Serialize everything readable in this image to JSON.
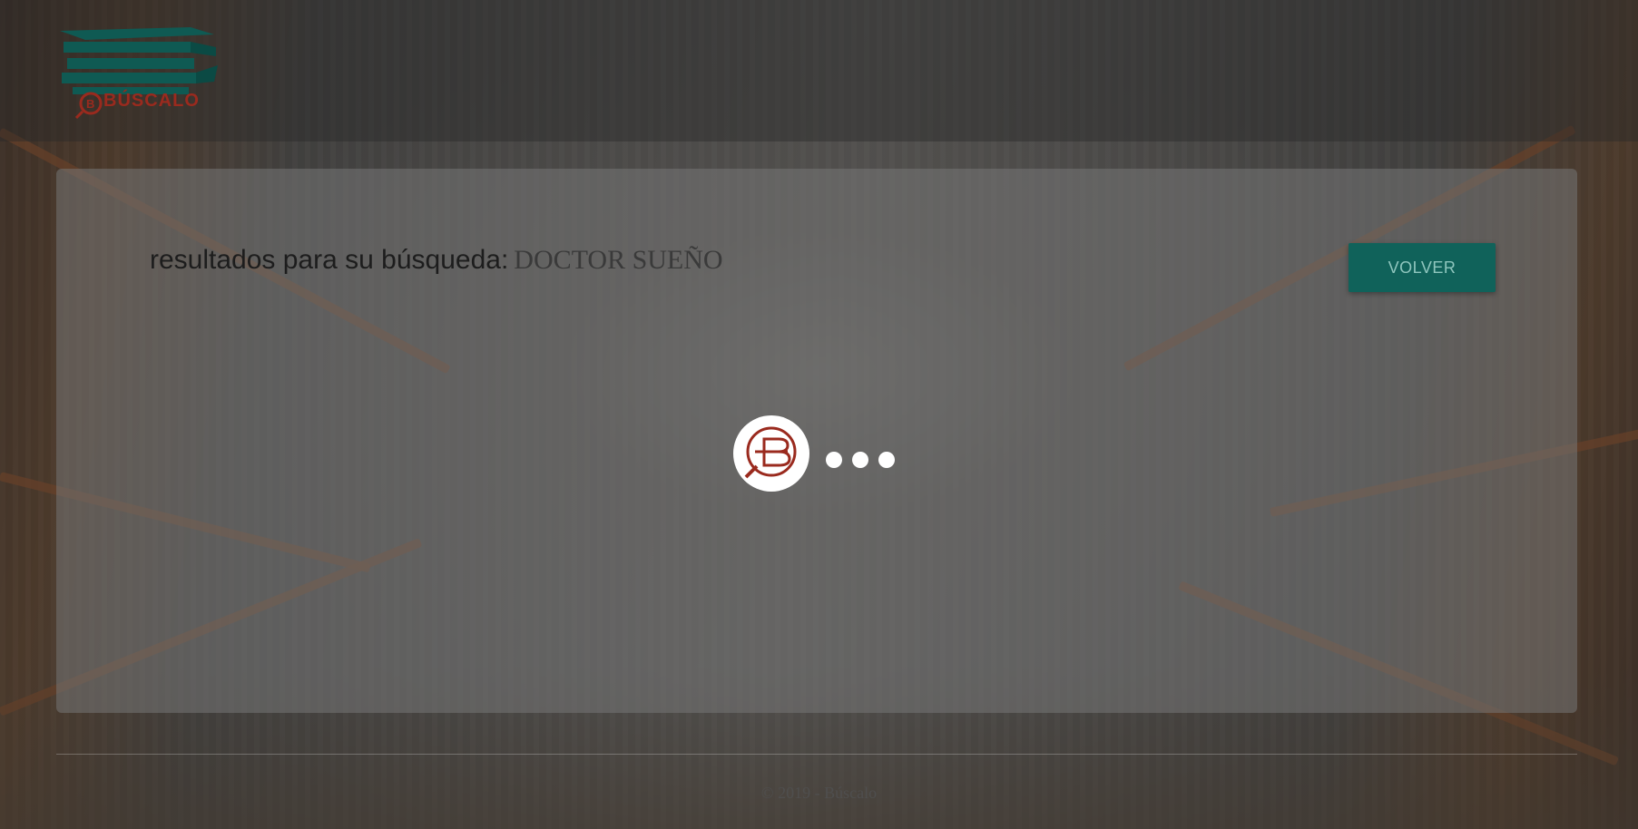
{
  "header": {
    "logo_text": "BÚSCALO"
  },
  "results": {
    "label": "resultados para su búsqueda:",
    "query": "DOCTOR SUEÑO"
  },
  "actions": {
    "back_label": "VOLVER"
  },
  "loader": {
    "icon": "buscalo-logo-icon",
    "dots": 3
  },
  "footer": {
    "copyright": "© 2019 - Búscalo"
  },
  "colors": {
    "accent": "#10625a",
    "brand": "#9a2a1e",
    "logo_books": "#0f5a53"
  }
}
